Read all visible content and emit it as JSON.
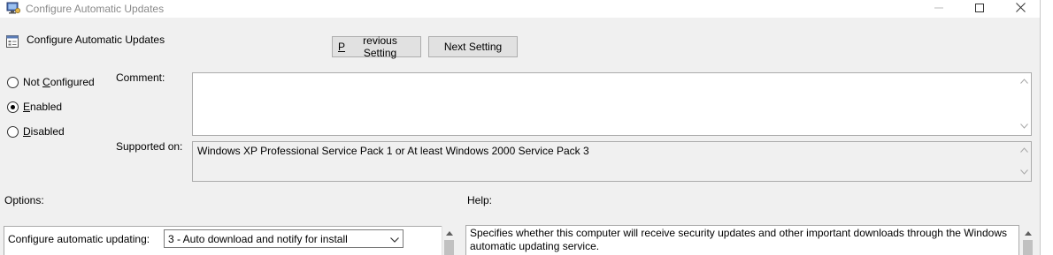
{
  "window": {
    "title": "Configure Automatic Updates",
    "controls": {
      "minimize_icon": "minimize-icon",
      "maximize_icon": "maximize-icon",
      "close_icon": "close-icon"
    }
  },
  "header": {
    "policy_title": "Configure Automatic Updates",
    "previous_button": {
      "accel": "P",
      "rest": "revious Setting"
    },
    "next_button": "Next Setting"
  },
  "state_options": [
    {
      "pre": "Not ",
      "accel": "C",
      "post": "onfigured",
      "selected": false
    },
    {
      "pre": "",
      "accel": "E",
      "post": "nabled",
      "selected": true
    },
    {
      "pre": "",
      "accel": "D",
      "post": "isabled",
      "selected": false
    }
  ],
  "comment": {
    "label": "Comment:",
    "value": ""
  },
  "supported_on": {
    "label": "Supported on:",
    "value": "Windows XP Professional Service Pack 1 or At least Windows 2000 Service Pack 3"
  },
  "options": {
    "label": "Options:",
    "configure_label": "Configure automatic updating:",
    "configure_value": "3 - Auto download and notify for install"
  },
  "help": {
    "label": "Help:",
    "text": "Specifies whether this computer will receive security updates and other important downloads through the Windows automatic updating service."
  },
  "colors": {
    "dialog_bg": "#f0f0f0",
    "border": "#ababab",
    "button_bg": "#e1e1e1"
  }
}
